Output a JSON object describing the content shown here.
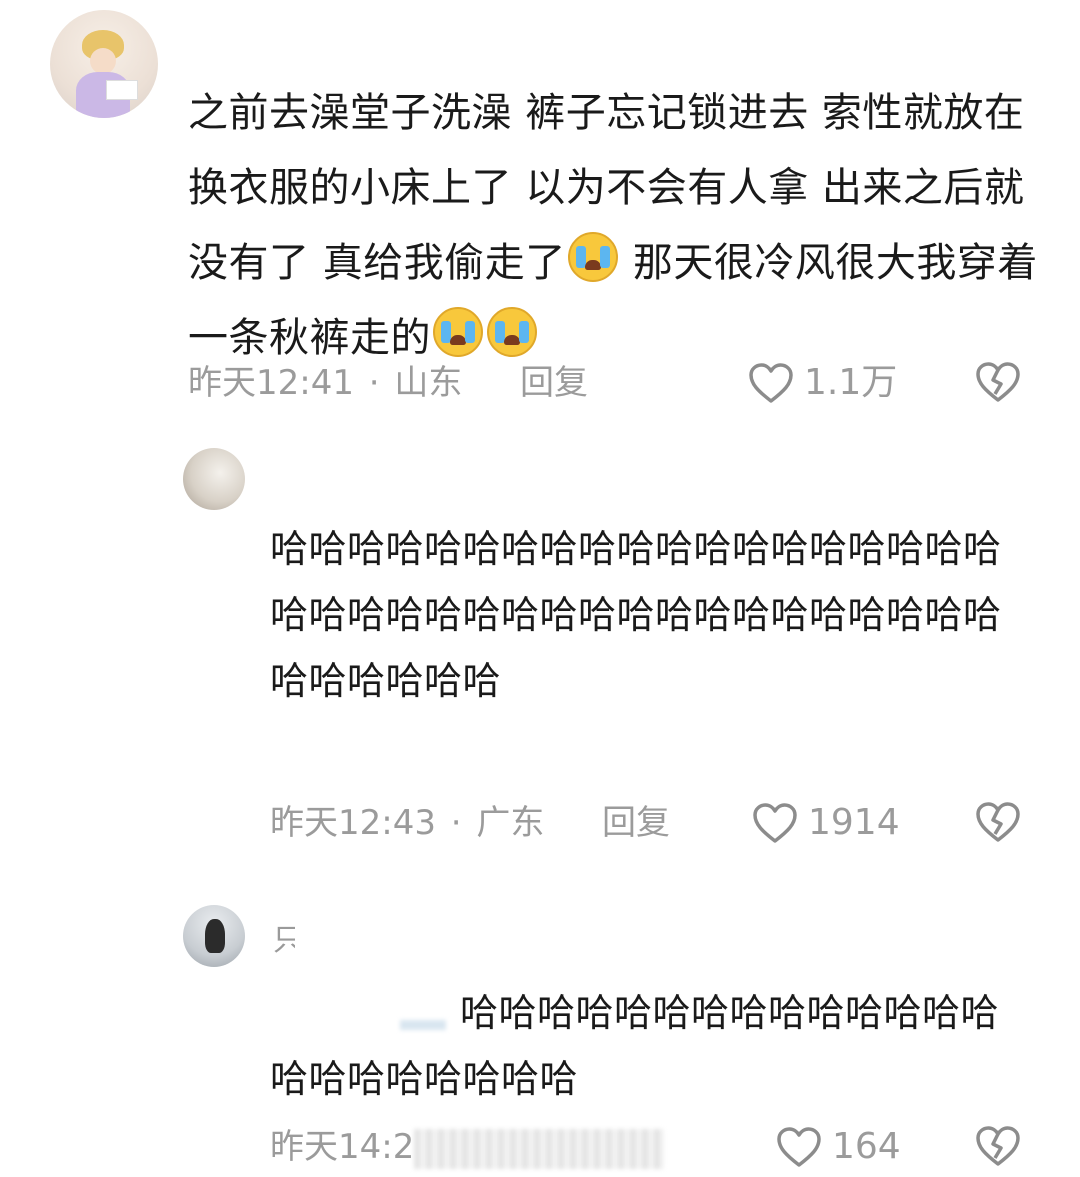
{
  "comments": [
    {
      "text_a": "之前去澡堂子洗澡 裤子忘记锁进去 索性就放在换衣服的小床上了 以为不会有人拿 出来之后就没有了 真给我偷走了",
      "text_b": " 那天很冷风很大我穿着一条秋裤走的",
      "emoji_name": "loudly-crying-face",
      "time": "昨天12:41",
      "dot": "·",
      "location": "山东",
      "reply_label": "回复",
      "likes": "1.1万"
    },
    {
      "text": "哈哈哈哈哈哈哈哈哈哈哈哈哈哈哈哈哈哈哈哈哈哈哈哈哈哈哈哈哈哈哈哈哈哈哈哈哈哈哈哈哈哈哈哈",
      "time": "昨天12:43",
      "dot": "·",
      "location": "广东",
      "reply_label": "回复",
      "likes": "1914"
    },
    {
      "username_partial": "只",
      "text": "哈哈哈哈哈哈哈哈哈哈哈哈哈哈哈哈哈哈哈哈哈哈",
      "time_partial": "昨天14:2",
      "likes": "164"
    }
  ],
  "icons": {
    "like": "heart-outline-icon",
    "dislike": "broken-heart-icon"
  },
  "colors": {
    "text": "#1a1a1a",
    "meta": "#9b9b9b",
    "icon": "#8c8c8c"
  }
}
